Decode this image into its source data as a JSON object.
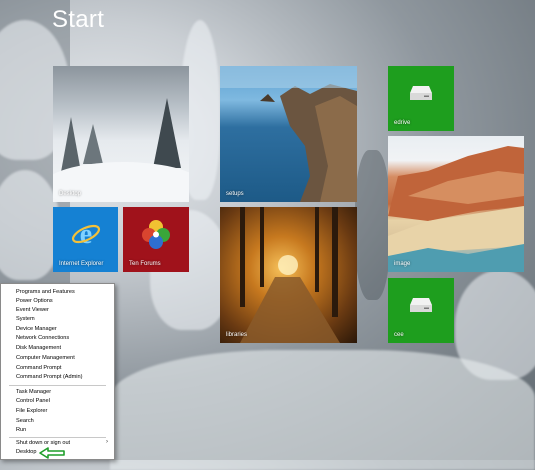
{
  "start": {
    "title": "Start"
  },
  "tiles": {
    "desktop": "Desktop",
    "setups": "setups",
    "edrive": "edrive",
    "ie": "Internet Explorer",
    "ten_forums": "Ten Forums",
    "libraries": "libraries",
    "image": "image",
    "cee": "cee"
  },
  "menu": {
    "items": [
      "Programs and Features",
      "Power Options",
      "Event Viewer",
      "System",
      "Device Manager",
      "Network Connections",
      "Disk Management",
      "Computer Management",
      "Command Prompt",
      "Command Prompt (Admin)",
      "Task Manager",
      "Control Panel",
      "File Explorer",
      "Search",
      "Run",
      "Shut down or sign out",
      "Desktop"
    ],
    "submenu_glyph": "›"
  },
  "colors": {
    "tile_green": "#1e9e1e",
    "tile_ie": "#1581d3",
    "tile_ten": "#a0121b",
    "arrow_green": "#1f9e2a"
  },
  "icons": [
    "internet-explorer-icon",
    "ten-forums-icon",
    "drive-icon",
    "green-arrow-icon"
  ]
}
